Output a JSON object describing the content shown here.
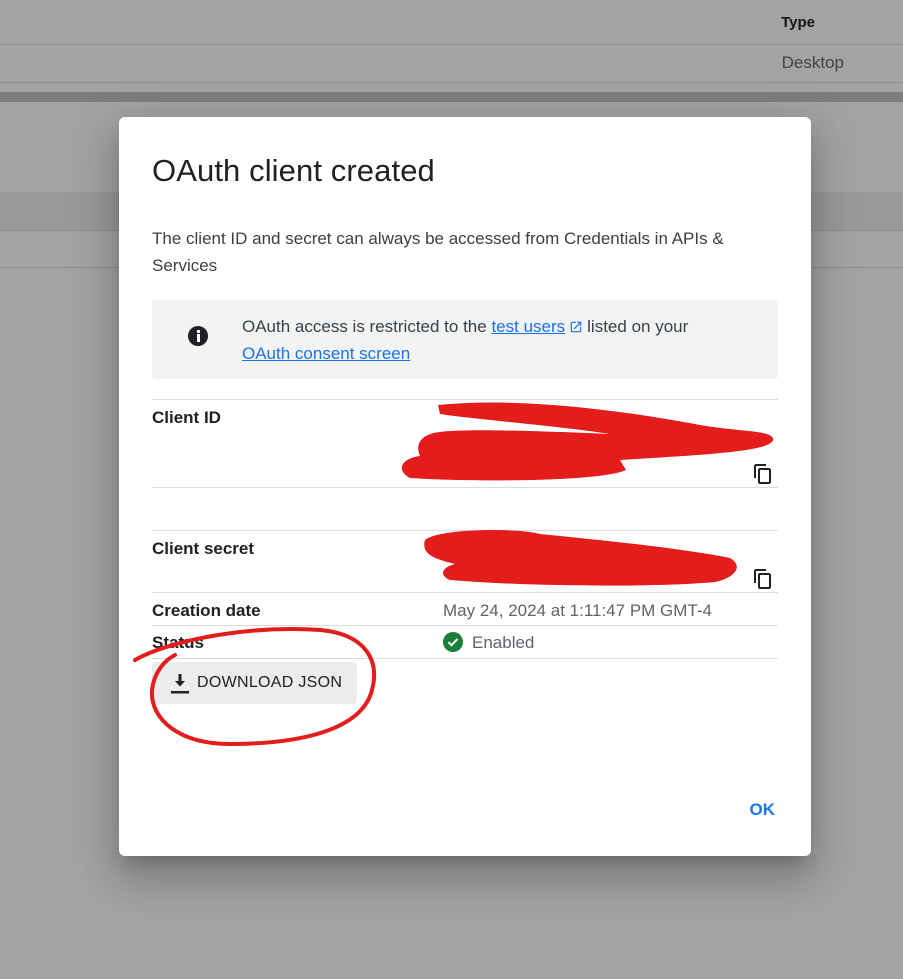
{
  "background": {
    "table_header_type": "Type",
    "table_cell_type": "Desktop"
  },
  "dialog": {
    "title": "OAuth client created",
    "description": "The client ID and secret can always be accessed from Credentials in APIs & Services",
    "notice": {
      "text_before": "OAuth access is restricted to the",
      "link_test_users": "test users",
      "text_middle": "listed on your",
      "link_consent": "OAuth consent screen",
      "icon": "info-icon"
    },
    "fields": {
      "client_id_label": "Client ID",
      "client_secret_label": "Client secret",
      "creation_date_label": "Creation date",
      "creation_date_value": "May 24, 2024 at 1:11:47 PM GMT-4",
      "status_label": "Status",
      "status_value": "Enabled"
    },
    "download_button": "DOWNLOAD JSON",
    "ok_button": "OK"
  },
  "colors": {
    "accent": "#1a73e8",
    "status_green": "#188038",
    "redaction": "#e31c1c"
  }
}
